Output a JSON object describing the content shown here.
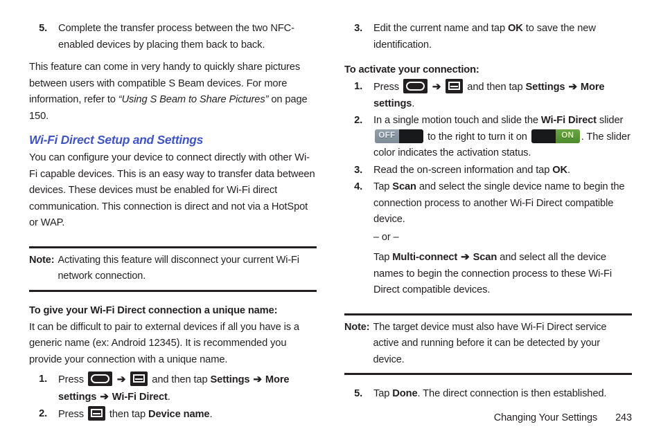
{
  "document": {
    "page_number": "243",
    "footer_section": "Changing Your Settings"
  },
  "left_column": {
    "step5": {
      "number": "5.",
      "text": "Complete the transfer process between the two NFC-enabled devices by placing them back to back."
    },
    "intro_paragraph": {
      "part1": "This feature can come in very handy to quickly share pictures between users with compatible S Beam devices. For more information, refer to ",
      "reference_italic": "“Using S Beam to Share Pictures”",
      "part2": " on page 150."
    },
    "section_heading": "Wi-Fi Direct Setup and Settings",
    "section_paragraph": "You can configure your device to connect directly with other Wi-Fi capable devices. This is an easy way to transfer data between devices. These devices must be enabled for Wi-Fi direct communication. This connection is direct and not via a HotSpot or WAP.",
    "note": {
      "label": "Note:",
      "text": "Activating this feature will disconnect your current Wi-Fi network connection."
    },
    "subheading": "To give your Wi-Fi Direct connection a unique name:",
    "unique_name_paragraph": "It can be difficult to pair to external devices if all you have is a generic name (ex: Android 12345). It is recommended you provide your connection with a unique name.",
    "step1": {
      "number": "1.",
      "press_label": "Press",
      "home_icon": "home-key-icon",
      "arrow": "➔",
      "menu_icon": "menu-key-icon",
      "mid_text": "and then tap",
      "settings_label": "Settings",
      "arrow2": "➔",
      "more_settings_label": "More settings",
      "arrow3": "➔",
      "wifi_direct_label": "Wi-Fi Direct",
      "period": "."
    },
    "step2": {
      "number": "2.",
      "press_label": "Press",
      "menu_icon": "menu-key-icon",
      "mid_text": "then tap",
      "device_name_label": "Device name",
      "period": "."
    }
  },
  "right_column": {
    "step3_edit": {
      "number": "3.",
      "pre": "Edit the current name and tap ",
      "bold": "OK",
      "post": " to save the new identification."
    },
    "subheading": "To activate your connection:",
    "step1": {
      "number": "1.",
      "press_label": "Press",
      "home_icon": "home-key-icon",
      "arrow": "➔",
      "menu_icon": "menu-key-icon",
      "mid_text": "and then tap",
      "settings_label": "Settings",
      "arrow2": "➔",
      "more_settings_label": "More settings",
      "period": "."
    },
    "step2": {
      "number": "2.",
      "pre": "In a single motion touch and slide the ",
      "bold1": "Wi-Fi Direct",
      "mid1": " slider ",
      "toggle_off_label": "OFF",
      "mid2": " to the right to turn it on ",
      "toggle_on_label": "ON",
      "post": ". The slider color indicates the activation status."
    },
    "step3_read": {
      "number": "3.",
      "pre": "Read the on-screen information and tap ",
      "bold": "OK",
      "post": "."
    },
    "step4": {
      "number": "4.",
      "pre": "Tap ",
      "bold1": "Scan",
      "post1": " and select the single device name to begin the connection process to another Wi-Fi Direct compatible device.",
      "or_separator": "– or –",
      "pre2": "Tap ",
      "bold2": "Multi-connect",
      "arrow": "➔",
      "bold3": "Scan",
      "post2": " and select all the device names to begin the connection process to these Wi-Fi Direct compatible devices."
    },
    "note": {
      "label": "Note:",
      "text": "The target device must also have Wi-Fi Direct service active and running before it can be detected by your device."
    },
    "step5": {
      "number": "5.",
      "pre": "Tap ",
      "bold": "Done",
      "post": ". The direct connection is then established."
    }
  },
  "colors": {
    "heading_blue": "#4054c4",
    "text_black": "#231f20",
    "toggle_on_green": "#5b9a38",
    "toggle_off_gray": "#8a97a4"
  }
}
